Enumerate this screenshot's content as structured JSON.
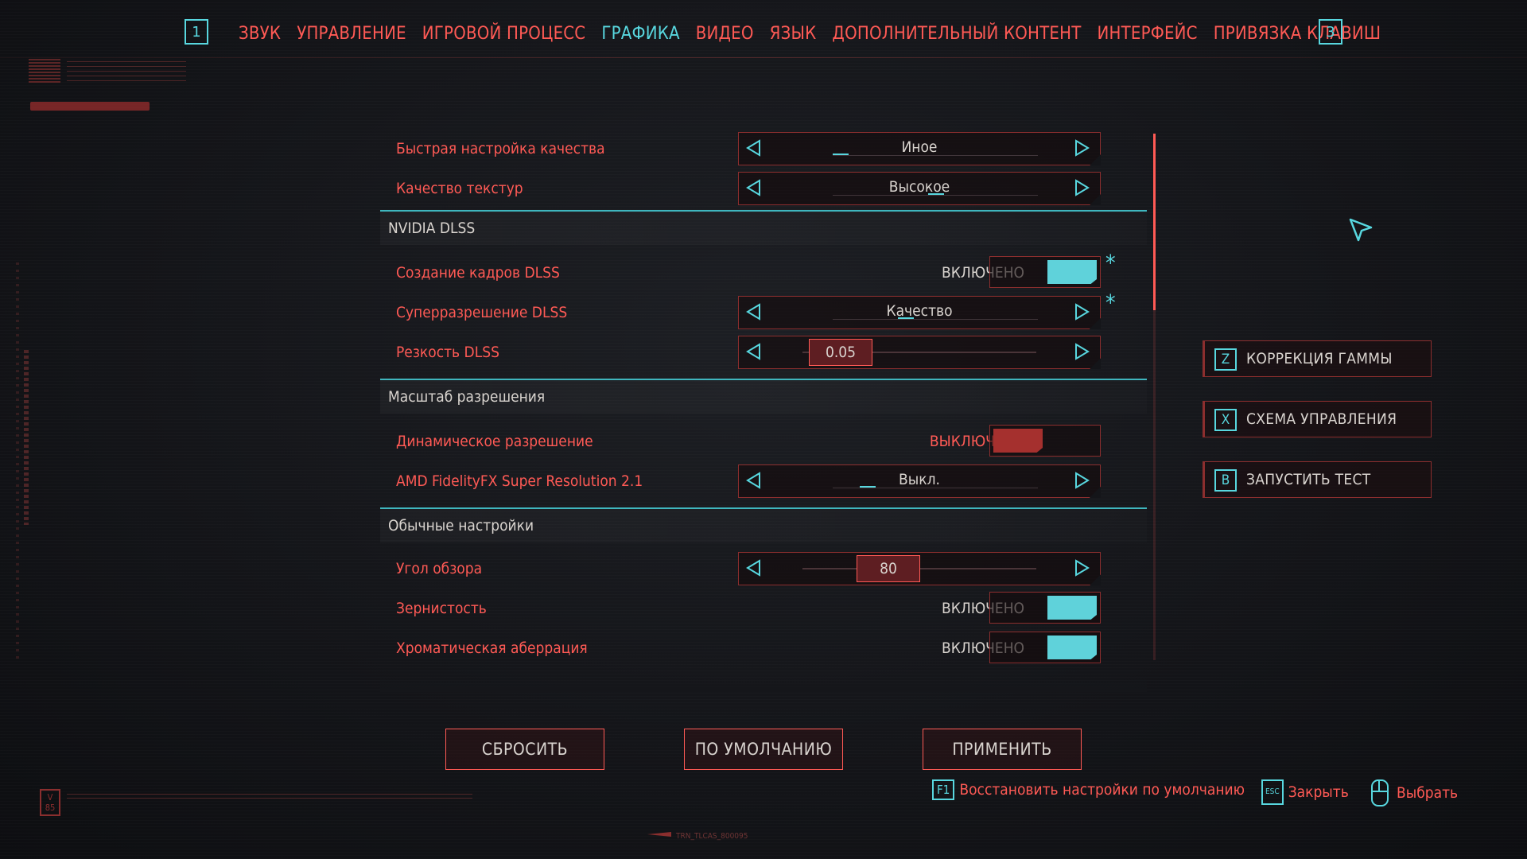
{
  "nav": {
    "prev_key": "1",
    "next_key": "3",
    "tabs": [
      {
        "label": "ЗВУК"
      },
      {
        "label": "УПРАВЛЕНИЕ"
      },
      {
        "label": "ИГРОВОЙ ПРОЦЕСС"
      },
      {
        "label": "ГРАФИКА",
        "active": true
      },
      {
        "label": "ВИДЕО"
      },
      {
        "label": "ЯЗЫК"
      },
      {
        "label": "ДОПОЛНИТЕЛЬНЫЙ КОНТЕНТ"
      },
      {
        "label": "ИНТЕРФЕЙС"
      },
      {
        "label": "ПРИВЯЗКА КЛАВИШ"
      }
    ]
  },
  "settings": {
    "quick_preset": {
      "label": "Быстрая настройка качества",
      "value": "Иное"
    },
    "texture_quality": {
      "label": "Качество текстур",
      "value": "Высокое"
    },
    "section_dlss": "NVIDIA DLSS",
    "dlss_frame_gen": {
      "label": "Создание кадров DLSS",
      "state_text": "ВКЛЮЧЕНО",
      "on": true
    },
    "dlss_super_res": {
      "label": "Суперразрешение DLSS",
      "value": "Качество"
    },
    "dlss_sharpness": {
      "label": "Резкость DLSS",
      "value": "0.05",
      "fraction": 0.02
    },
    "section_scale": "Масштаб разрешения",
    "dynamic_res": {
      "label": "Динамическое разрешение",
      "state_text": "ВЫКЛЮЧЕНО",
      "on": false
    },
    "fsr": {
      "label": "AMD FidelityFX Super Resolution 2.1",
      "value": "Выкл."
    },
    "section_basic": "Обычные настройки",
    "fov": {
      "label": "Угол обзора",
      "value": "80"
    },
    "grain": {
      "label": "Зернистость",
      "state_text": "ВКЛЮЧЕНО",
      "on": true
    },
    "chromatic": {
      "label": "Хроматическая аберрация",
      "state_text": "ВКЛЮЧЕНО",
      "on": true
    }
  },
  "asterisk": "*",
  "side_buttons": {
    "gamma": {
      "key": "Z",
      "label": "КОРРЕКЦИЯ ГАММЫ"
    },
    "scheme": {
      "key": "X",
      "label": "СХЕМА УПРАВЛЕНИЯ"
    },
    "bench": {
      "key": "B",
      "label": "ЗАПУСТИТЬ ТЕСТ"
    }
  },
  "bottom": {
    "reset": "СБРОСИТЬ",
    "defaults": "ПО УМОЛЧАНИЮ",
    "apply": "ПРИМЕНИТЬ",
    "hint_restore_key": "F1",
    "hint_restore": "Восстановить настройки по умолчанию",
    "hint_close_key": "ESC",
    "hint_close": "Закрыть",
    "hint_select": "Выбрать"
  },
  "hud": {
    "version_logo": "V 85",
    "bottom_id": "TRN_TLCAS_800095"
  },
  "colors": {
    "accent_red": "#ff5a55",
    "accent_cyan": "#58d7df",
    "toggle_on": "#5fd2da",
    "toggle_off": "#a5302e",
    "background": "#15161a"
  }
}
